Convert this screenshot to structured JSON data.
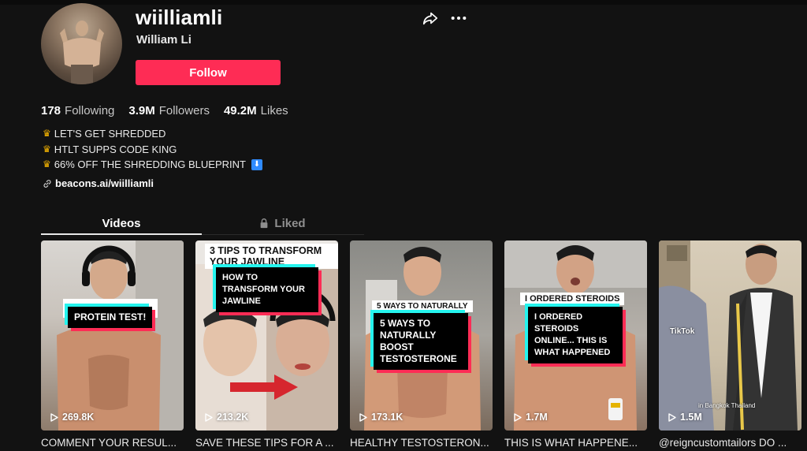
{
  "profile": {
    "username": "wiilliamli",
    "nickname": "William Li",
    "follow_label": "Follow"
  },
  "stats": [
    {
      "value": "178",
      "label": "Following"
    },
    {
      "value": "3.9M",
      "label": "Followers"
    },
    {
      "value": "49.2M",
      "label": "Likes"
    }
  ],
  "bio": [
    "LET'S GET SHREDDED",
    "HTLT SUPPS CODE KING",
    "66% OFF THE SHREDDING BLUEPRINT"
  ],
  "link": "beacons.ai/wiilliamli",
  "tabs": {
    "videos": "Videos",
    "liked": "Liked"
  },
  "videos": [
    {
      "views": "269.8K",
      "caption": "COMMENT YOUR RESUL...",
      "overlay_main": "PROTEIN TEST!",
      "overlay_top": ""
    },
    {
      "views": "213.2K",
      "caption": "SAVE THESE TIPS FOR A ...",
      "overlay_main": "HOW TO TRANSFORM YOUR JAWLINE",
      "overlay_top": "3 TIPS TO TRANSFORM YOUR JAWLINE"
    },
    {
      "views": "173.1K",
      "caption": "HEALTHY TESTOSTERON...",
      "overlay_main": "5 WAYS TO NATURALLY BOOST TESTOSTERONE",
      "overlay_top": "5 WAYS TO NATURALLY"
    },
    {
      "views": "1.7M",
      "caption": "THIS IS WHAT HAPPENE...",
      "overlay_main": "I ORDERED STEROIDS ONLINE... THIS IS WHAT HAPPENED",
      "overlay_top": "I ORDERED STEROIDS"
    },
    {
      "views": "1.5M",
      "caption": "@reigncustomtailors DO ...",
      "overlay_main": "",
      "overlay_top": "",
      "watermark": "TikTok",
      "location": "in Bangkok Thailand"
    }
  ],
  "colors": {
    "accent": "#fe2c55",
    "teal": "#25f4ee",
    "background": "#121212"
  }
}
